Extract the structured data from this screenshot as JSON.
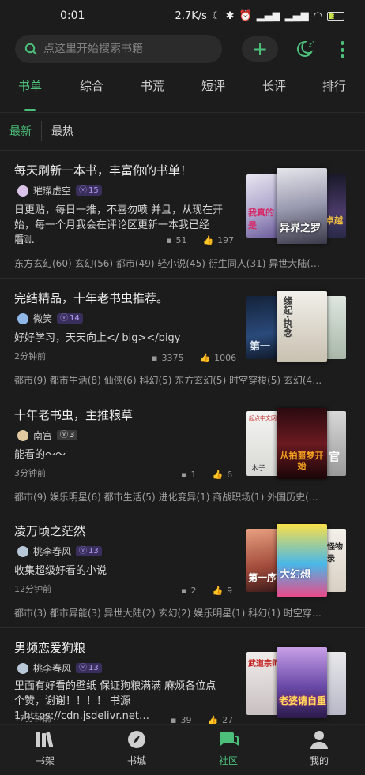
{
  "status_bar": {
    "time": "0:01",
    "net_speed": "2.7K/s",
    "battery": "34"
  },
  "search": {
    "placeholder": "点这里开始搜索书籍"
  },
  "tabs": [
    {
      "label": "书单",
      "active": true
    },
    {
      "label": "综合",
      "active": false
    },
    {
      "label": "书荒",
      "active": false
    },
    {
      "label": "短评",
      "active": false
    },
    {
      "label": "长评",
      "active": false
    },
    {
      "label": "排行",
      "active": false
    }
  ],
  "sort": {
    "latest": "最新",
    "hottest": "最热"
  },
  "cards": [
    {
      "title": "每天刷新一本书，丰富你的书单！",
      "author": "璀璨虚空",
      "level": "15",
      "desc": "日更贴，每日一推，不喜勿喷 并且，从现在开始，每一个月我会在评论区更新一本我已经看…",
      "time": "刚刚",
      "comments": "51",
      "likes": "197",
      "tags": "东方玄幻(60) 玄幻(56) 都市(49) 轻小说(45) 衍生同人(31) 异世大陆(28) 时…"
    },
    {
      "title": "完结精品，十年老书虫推荐。",
      "author": "微笑",
      "level": "14",
      "desc": "好好学习，天天向上</ big></bigy",
      "time": "2分钟前",
      "comments": "3375",
      "likes": "1006",
      "tags": "都市(9) 都市生活(8) 仙侠(6) 科幻(5) 东方玄幻(5) 时空穿梭(5) 玄幻(4) 幻想…"
    },
    {
      "title": "十年老书虫，主推粮草",
      "author": "南宫",
      "level": "3",
      "desc": "能看的～～",
      "time": "3分钟前",
      "comments": "1",
      "likes": "6",
      "tags": "都市(9) 娱乐明星(6) 都市生活(5) 进化变异(1) 商战职场(1) 外国历史(1) 高…"
    },
    {
      "title": "凌万顷之茫然",
      "author": "桃李春风",
      "level": "13",
      "desc": "收集超级好看的小说",
      "time": "12分钟前",
      "comments": "2",
      "likes": "9",
      "tags": "都市(3) 都市异能(3) 异世大陆(2) 玄幻(2) 娱乐明星(1) 科幻(1) 时空穿梭(1) …"
    },
    {
      "title": "男频恋爱狗粮",
      "author": "桃李春风",
      "level": "13",
      "desc": "里面有好看的壁纸 保证狗粮满满 麻烦各位点个赞，谢谢！！！！ 书源 1.https://cdn.jsdelivr.net…",
      "time": "12分钟前",
      "comments": "39",
      "likes": "27",
      "tags": ""
    }
  ],
  "cover_texts": {
    "c1a": "我真的是",
    "c1b": "异界之罗",
    "c1c": "卓越",
    "c2a": "第一",
    "c2b": "缘起·执念",
    "c3a": "起点中文网",
    "c3b": "从拍噩梦开始",
    "c3c": "官",
    "c3d": "木子",
    "c4a": "第一序",
    "c4b": "大幻想",
    "c4c": "怪物录",
    "c5a": "武道宗师",
    "c5b": "老婆请自重"
  },
  "bottom_nav": [
    {
      "label": "书架",
      "icon": "bookshelf-icon",
      "active": false
    },
    {
      "label": "书城",
      "icon": "compass-icon",
      "active": false
    },
    {
      "label": "社区",
      "icon": "chat-icon",
      "active": true
    },
    {
      "label": "我的",
      "icon": "person-icon",
      "active": false
    }
  ],
  "colors": {
    "accent": "#4cc07a",
    "background": "#1c1c1c",
    "level_badge": "#b49cf2"
  }
}
